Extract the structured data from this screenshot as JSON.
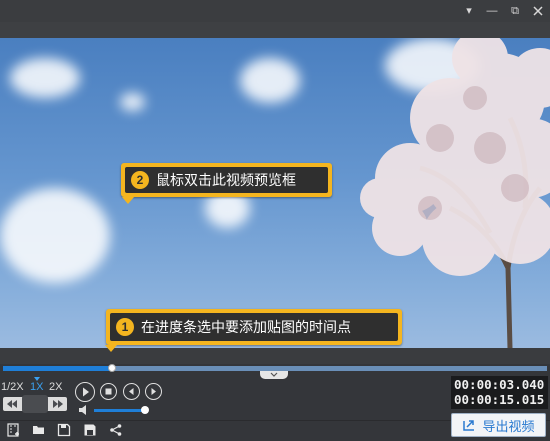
{
  "window": {
    "dropdown_glyph": "▾",
    "minimize_glyph": "—",
    "restore_glyph": "⧉"
  },
  "callouts": [
    {
      "number": "2",
      "text": "鼠标双击此视频预览框"
    },
    {
      "number": "1",
      "text": "在进度条选中要添加贴图的时间点"
    }
  ],
  "playback": {
    "progress": 0.2,
    "speeds": [
      "1/2X",
      "1X",
      "2X"
    ],
    "active_speed": "1X",
    "volume": 0.95,
    "current_time": "00:00:03.040",
    "total_time": "00:00:15.015"
  },
  "toolbar": {
    "export_label": "导出视频"
  },
  "icons": [
    "film-add-icon",
    "folder-open-icon",
    "save-icon",
    "save-as-icon",
    "share-icon",
    "play-icon",
    "stop-icon",
    "prev-frame-icon",
    "next-frame-icon",
    "volume-icon",
    "export-icon"
  ],
  "colors": {
    "accent": "#1f7fd8",
    "callout": "#f4b51f"
  }
}
